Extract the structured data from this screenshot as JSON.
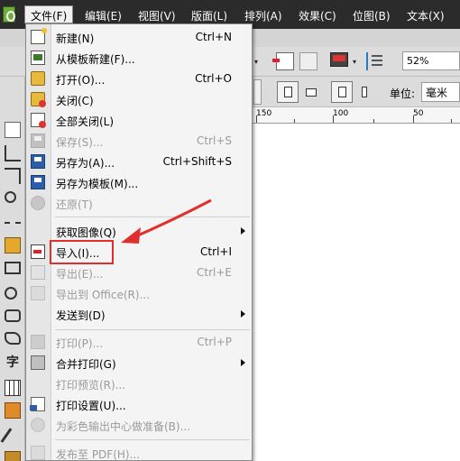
{
  "menubar": {
    "items": [
      {
        "label": "文件(F)"
      },
      {
        "label": "编辑(E)"
      },
      {
        "label": "视图(V)"
      },
      {
        "label": "版面(L)"
      },
      {
        "label": "排列(A)"
      },
      {
        "label": "效果(C)"
      },
      {
        "label": "位图(B)"
      },
      {
        "label": "文本(X)"
      }
    ]
  },
  "toolbar": {
    "zoom": "52%",
    "unit_label": "单位:",
    "unit_value": "毫米"
  },
  "ruler": {
    "ticks": [
      "150",
      "100",
      "50"
    ]
  },
  "file_menu": {
    "items": [
      {
        "label": "新建(N)",
        "shortcut": "Ctrl+N",
        "enabled": true
      },
      {
        "label": "从模板新建(F)...",
        "shortcut": "",
        "enabled": true
      },
      {
        "label": "打开(O)...",
        "shortcut": "Ctrl+O",
        "enabled": true
      },
      {
        "label": "关闭(C)",
        "shortcut": "",
        "enabled": true
      },
      {
        "label": "全部关闭(L)",
        "shortcut": "",
        "enabled": true
      },
      {
        "label": "保存(S)...",
        "shortcut": "Ctrl+S",
        "enabled": false
      },
      {
        "label": "另存为(A)...",
        "shortcut": "Ctrl+Shift+S",
        "enabled": true
      },
      {
        "label": "另存为模板(M)...",
        "shortcut": "",
        "enabled": true
      },
      {
        "label": "还原(T)",
        "shortcut": "",
        "enabled": false
      },
      {
        "label": "获取图像(Q)",
        "shortcut": "",
        "enabled": true
      },
      {
        "label": "导入(I)...",
        "shortcut": "Ctrl+I",
        "enabled": true
      },
      {
        "label": "导出(E)...",
        "shortcut": "Ctrl+E",
        "enabled": false
      },
      {
        "label": "导出到 Office(R)...",
        "shortcut": "",
        "enabled": false
      },
      {
        "label": "发送到(D)",
        "shortcut": "",
        "enabled": true
      },
      {
        "label": "打印(P)...",
        "shortcut": "Ctrl+P",
        "enabled": false
      },
      {
        "label": "合并打印(G)",
        "shortcut": "",
        "enabled": true
      },
      {
        "label": "打印预览(R)...",
        "shortcut": "",
        "enabled": false
      },
      {
        "label": "打印设置(U)...",
        "shortcut": "",
        "enabled": true
      },
      {
        "label": "为彩色输出中心做准备(B)...",
        "shortcut": "",
        "enabled": false
      },
      {
        "label": "发布至 PDF(H)...",
        "shortcut": "",
        "enabled": false
      }
    ]
  },
  "annotation": {
    "highlight_color": "#e0302e"
  }
}
